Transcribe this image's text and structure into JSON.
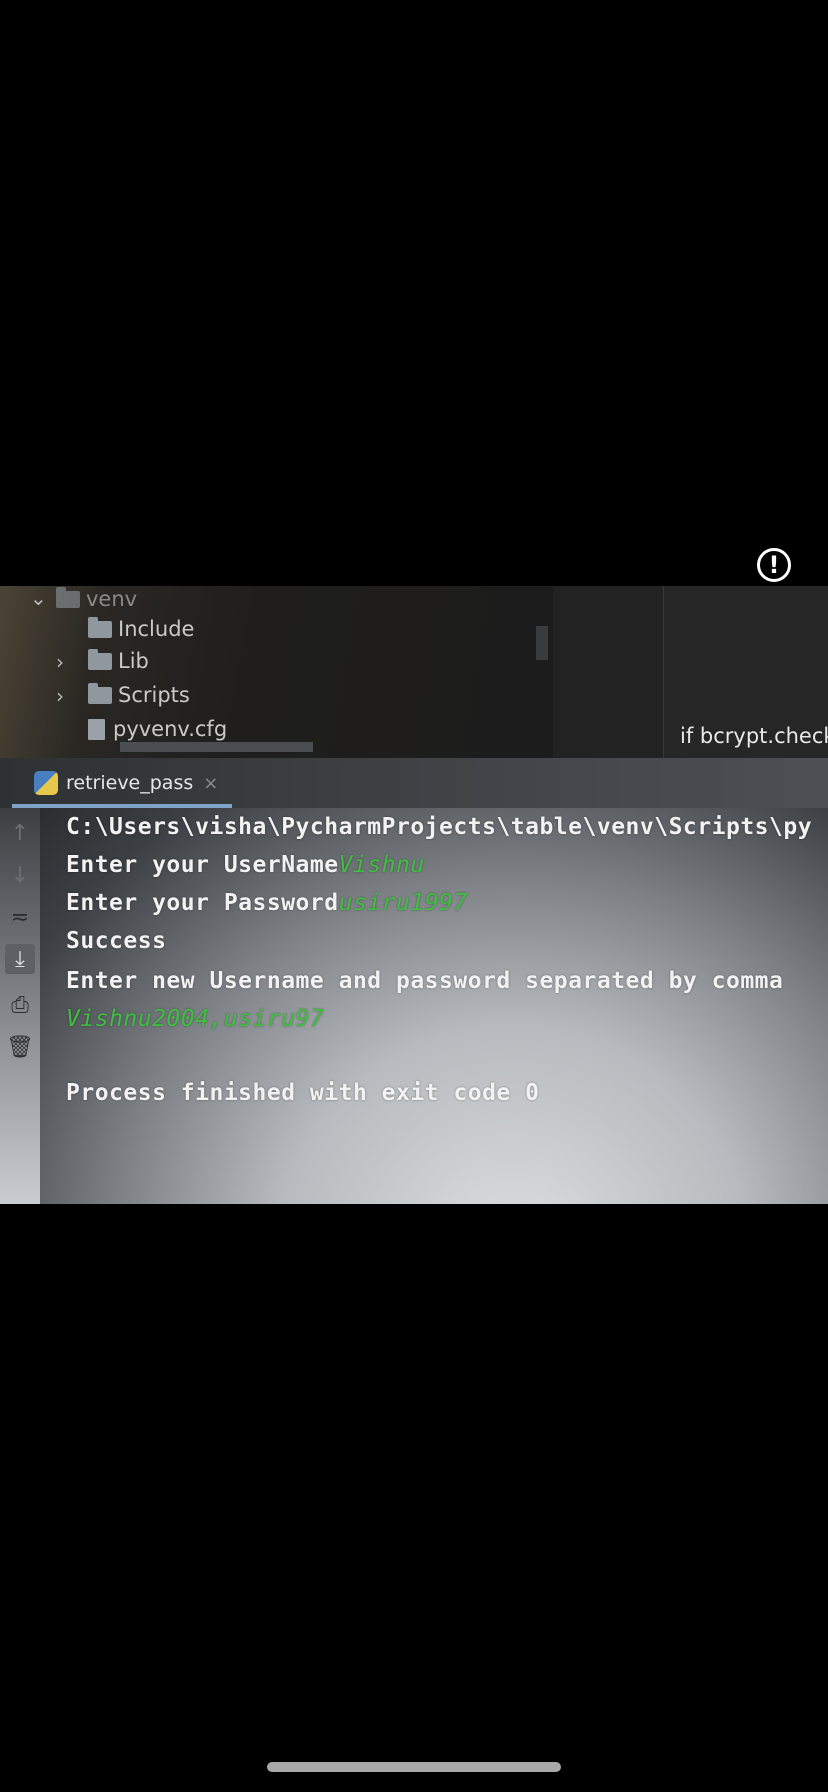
{
  "project_tree": {
    "items": [
      {
        "label": "venv",
        "type": "folder",
        "expanded": true
      },
      {
        "label": "Include",
        "type": "folder"
      },
      {
        "label": "Lib",
        "type": "folder",
        "collapsed": true
      },
      {
        "label": "Scripts",
        "type": "folder",
        "collapsed": true
      },
      {
        "label": "pyvenv.cfg",
        "type": "file"
      }
    ]
  },
  "editor": {
    "code_snippet": "if bcrypt.checkp"
  },
  "run_tab": {
    "label": "retrieve_pass",
    "close_icon": "×"
  },
  "toolbar_icons": [
    "up-arrow-icon",
    "down-arrow-icon",
    "soft-wrap-icon",
    "scroll-to-end-icon",
    "print-icon",
    "trash-icon"
  ],
  "console": {
    "path_line": "C:\\Users\\visha\\PycharmProjects\\table\\venv\\Scripts\\py",
    "prompt_username": "Enter your UserName",
    "input_username": "Vishnu",
    "prompt_password": "Enter your Password",
    "input_password": "usiru1997",
    "success": "Success",
    "prompt_new": "Enter new Username and password separated by comma",
    "input_new": "Vishnu2004,usiru97",
    "exit_message": "Process finished with exit code 0"
  },
  "colors": {
    "console_input": "#3fbf3f",
    "console_text": "#f2f2f2",
    "tab_underline": "#7fa3c8"
  }
}
